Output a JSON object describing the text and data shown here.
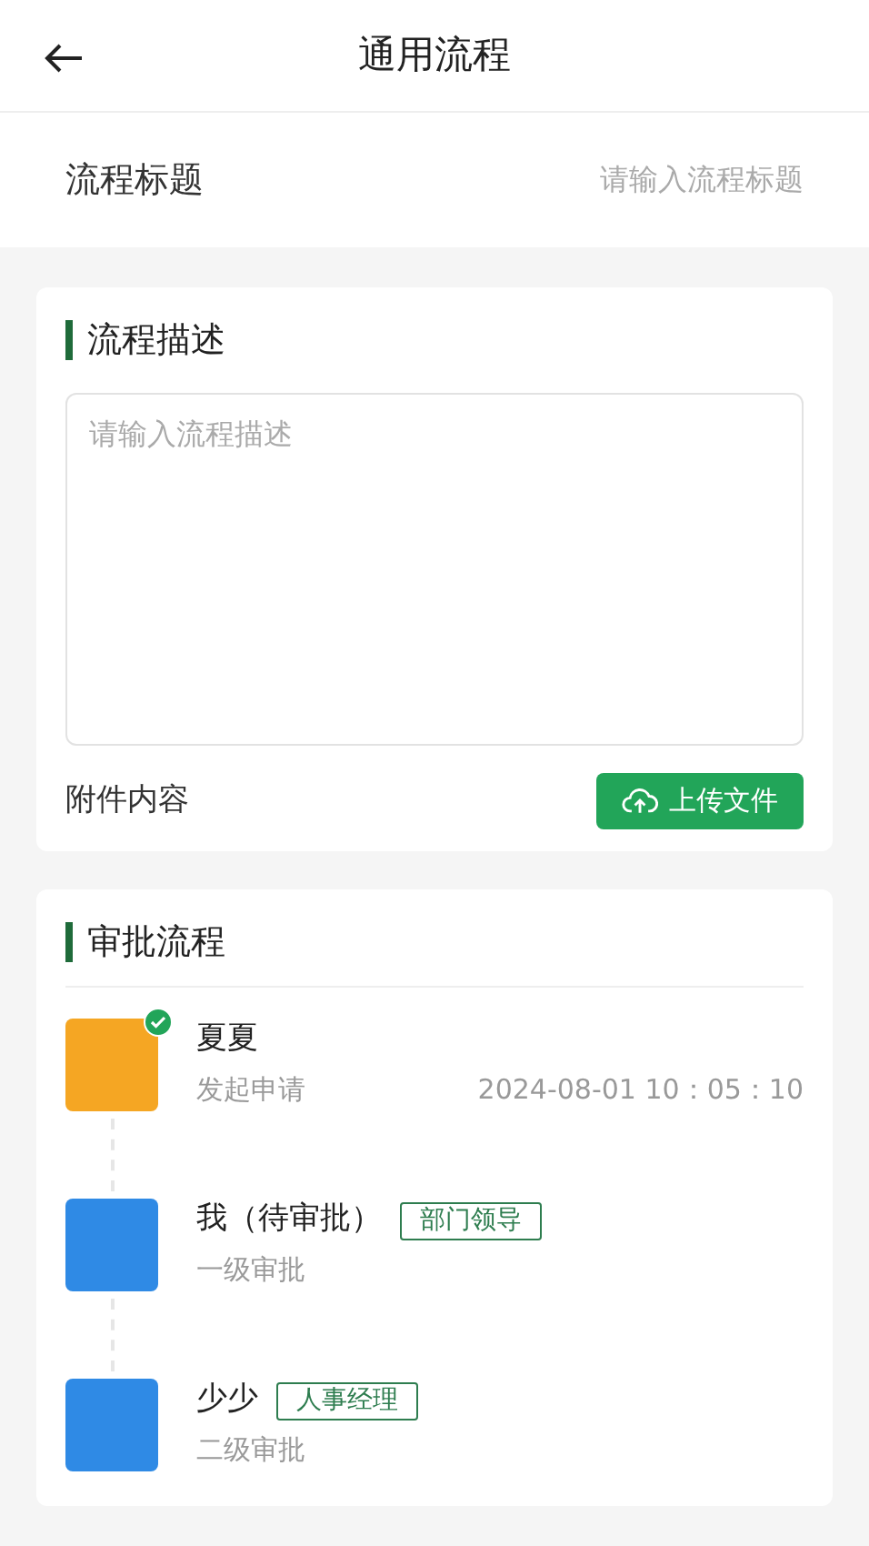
{
  "header": {
    "title": "通用流程"
  },
  "title_field": {
    "label": "流程标题",
    "placeholder": "请输入流程标题"
  },
  "description": {
    "heading": "流程描述",
    "placeholder": "请输入流程描述",
    "attachment_label": "附件内容",
    "upload_button": "上传文件"
  },
  "approval": {
    "heading": "审批流程",
    "steps": [
      {
        "name": "夏夏",
        "subtitle": "发起申请",
        "time": "2024-08-01 10：05：10",
        "color": "#f5a623",
        "checked": true
      },
      {
        "name": "我（待审批）",
        "tag": "部门领导",
        "subtitle": "一级审批",
        "color": "#2f8ae5",
        "checked": false
      },
      {
        "name": "少少",
        "tag": "人事经理",
        "subtitle": "二级审批",
        "color": "#2f8ae5",
        "checked": false
      }
    ]
  }
}
